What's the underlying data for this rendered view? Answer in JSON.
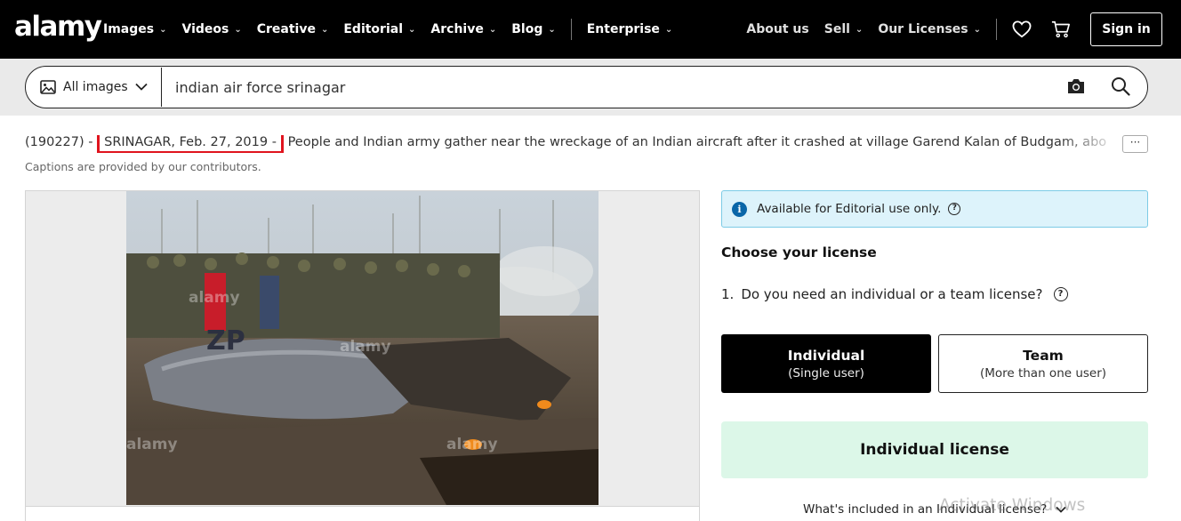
{
  "brand": {
    "logo": "alamy"
  },
  "nav": {
    "left": [
      {
        "label": "Images"
      },
      {
        "label": "Videos"
      },
      {
        "label": "Creative"
      },
      {
        "label": "Editorial"
      },
      {
        "label": "Archive"
      },
      {
        "label": "Blog"
      }
    ],
    "enterprise": "Enterprise",
    "about": "About us",
    "sell": "Sell",
    "licenses": "Our Licenses",
    "signin": "Sign in",
    "icons": {
      "favorites": "heart-icon",
      "cart": "cart-icon"
    }
  },
  "search": {
    "scope_label": "All images",
    "query": "indian air force srinagar",
    "icons": {
      "scope": "image-icon",
      "camera": "camera-icon",
      "search": "search-icon"
    }
  },
  "caption": {
    "id_prefix": "(190227) -",
    "highlighted": "SRINAGAR, Feb. 27, 2019 -",
    "text": "People and Indian army gather near the wreckage of an Indian aircraft after it crashed at village Garend Kalan of Budgam, abo",
    "more_label": "···",
    "note": "Captions are provided by our contributors."
  },
  "photo": {
    "watermark": "alamy"
  },
  "license": {
    "notice": "Available for Editorial use only.",
    "title": "Choose your license",
    "question_number": "1.",
    "question": "Do you need an individual or a team license?",
    "options": [
      {
        "title": "Individual",
        "subtitle": "(Single user)",
        "selected": true
      },
      {
        "title": "Team",
        "subtitle": "(More than one user)",
        "selected": false
      }
    ],
    "selected_license": "Individual license",
    "included": "What's included in an Individual license?"
  },
  "overlay": {
    "windows_watermark": "Activate Windows"
  },
  "colors": {
    "nav_bg": "#000000",
    "highlight_box": "#e0141e",
    "license_bg": "#dcf7e8",
    "notice_bg": "#ddf3fb"
  }
}
